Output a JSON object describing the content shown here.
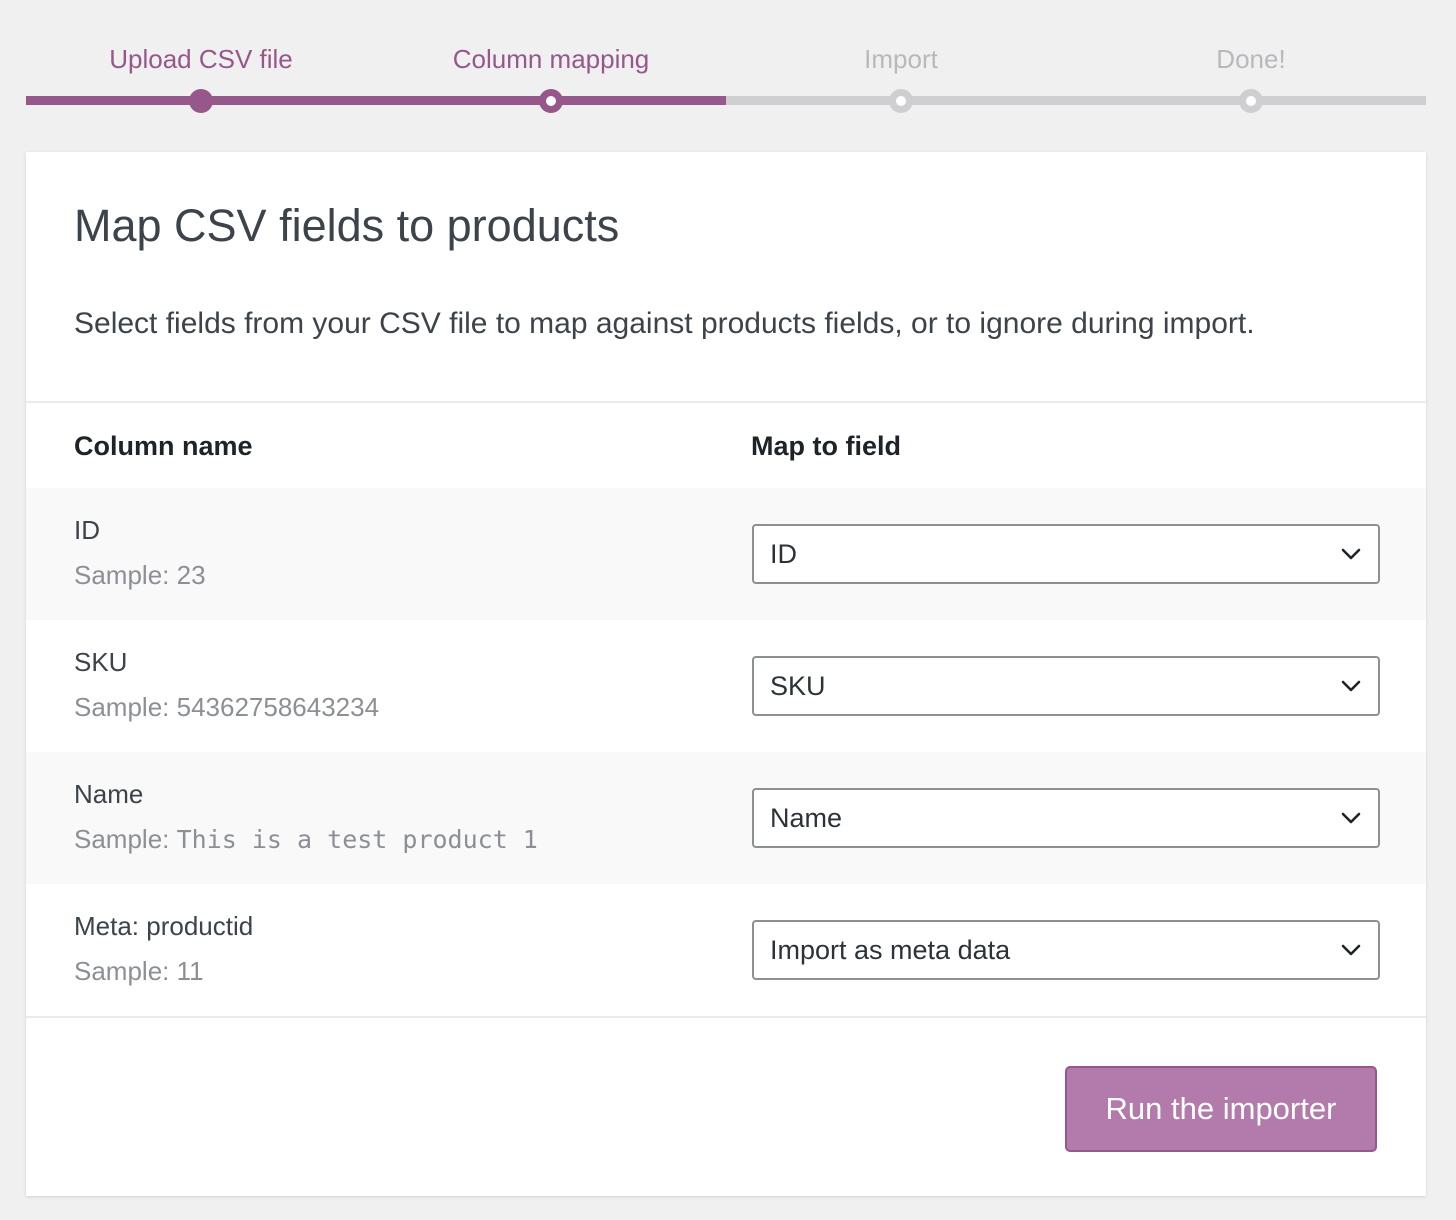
{
  "stepper": {
    "steps": [
      {
        "label": "Upload CSV file",
        "state": "done"
      },
      {
        "label": "Column mapping",
        "state": "active"
      },
      {
        "label": "Import",
        "state": "todo"
      },
      {
        "label": "Done!",
        "state": "todo"
      }
    ],
    "colors": {
      "accent": "#96588a",
      "inactive": "#cfcfd1",
      "inactive_text": "#b9b9bc"
    }
  },
  "card": {
    "title": "Map CSV fields to products",
    "description": "Select fields from your CSV file to map against products fields, or to ignore during import."
  },
  "table": {
    "headers": {
      "column_name": "Column name",
      "map_to_field": "Map to field"
    },
    "rows": [
      {
        "name": "ID",
        "sample_label": "Sample:",
        "sample_value": "23",
        "mapped_field": "ID"
      },
      {
        "name": "SKU",
        "sample_label": "Sample:",
        "sample_value": "54362758643234",
        "mapped_field": "SKU"
      },
      {
        "name": "Name",
        "sample_label": "Sample:",
        "sample_value": "This is a test product 1",
        "mapped_field": "Name"
      },
      {
        "name": "Meta: productid",
        "sample_label": "Sample:",
        "sample_value": "11",
        "mapped_field": "Import as meta data"
      }
    ]
  },
  "footer": {
    "run_button_label": "Run the importer",
    "button_color": "#b27bab"
  }
}
